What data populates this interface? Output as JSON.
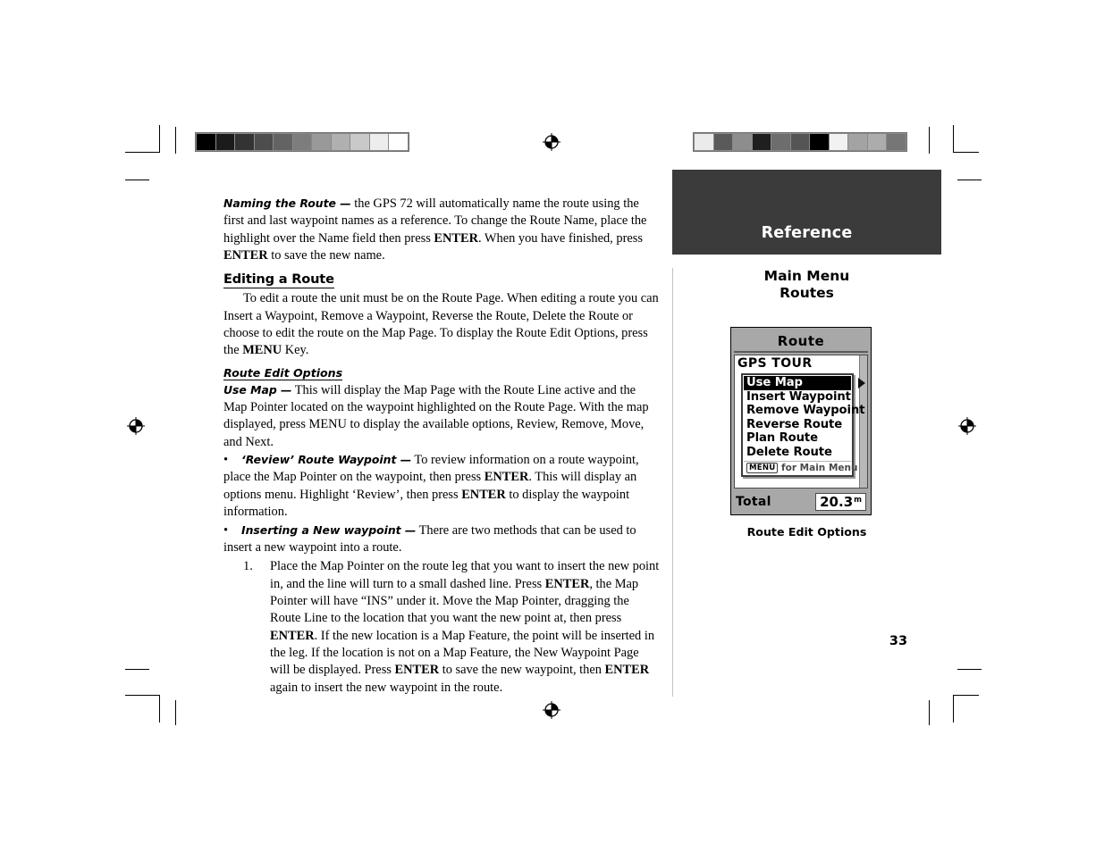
{
  "page": {
    "number": "33",
    "banner_label": "Reference",
    "sidebar_title_line1": "Main Menu",
    "sidebar_title_line2": "Routes",
    "figure_caption": "Route Edit Options"
  },
  "colors": {
    "banner_background": "#3b3b3b",
    "banner_text": "#ffffff",
    "rule": "#c3c3c3",
    "device_chrome": "#a8a8a8",
    "device_screen": "#ffffff",
    "highlight": "#000000"
  },
  "calibration": {
    "left_strip": [
      "#000000",
      "#1b1b1b",
      "#333333",
      "#4d4d4d",
      "#636363",
      "#7d7d7d",
      "#999999",
      "#b0b0b0",
      "#c9c9c9",
      "#ededed",
      "#ffffff"
    ],
    "right_strip": [
      "#ebebeb",
      "#5a5a5a",
      "#8d8d8d",
      "#1f1f1f",
      "#6d6d6d",
      "#555555",
      "#000000",
      "#f2f2f2",
      "#a3a3a3",
      "#acacac",
      "#767676"
    ]
  },
  "content": {
    "naming_route": {
      "lead": "Naming the Route —",
      "text_1": " the GPS 72 will automatically name the route using the first and last waypoint names as a reference.  To change the Route Name, place the highlight over the Name field then press ",
      "key_1": "ENTER",
      "text_2": ".  When you have finished, press ",
      "key_2": "ENTER",
      "text_3": " to save the new name."
    },
    "editing_route_heading": "Editing a Route",
    "editing_route_body": {
      "text_1": "To edit a route the unit must be on the Route Page.  When editing a route you can Insert a Waypoint, Remove a Waypoint, Reverse the Route, Delete the Route or choose to edit the route on the Map Page.  To display the Route Edit Options, press the ",
      "key_1": "MENU",
      "text_2": " Key."
    },
    "route_edit_options_heading": "Route Edit Options",
    "use_map": {
      "lead": "Use Map —",
      "text_1": " This will display the Map Page with the Route Line active and the Map Pointer located on the waypoint highlighted on the Route Page.  With the map displayed, press MENU to display the available options, Review, Remove, Move, and Next."
    },
    "review_waypoint": {
      "bullet": "•",
      "lead": "‘Review’ Route Waypoint —",
      "text_1": " To review information on a route waypoint, place     the Map Pointer on the waypoint, then press ",
      "key_1": "ENTER",
      "text_2": ". This will display an options menu. Highlight ‘Review’, then press ",
      "key_2": "ENTER",
      "text_3": " to display the waypoint information."
    },
    "inserting_waypoint": {
      "bullet": "•",
      "lead": "Inserting a New waypoint —",
      "text_1": " There are two methods that can be used to insert     a new waypoint into a route."
    },
    "step_1": {
      "num": "1.",
      "text_1": "Place the Map Pointer on the route leg that you want to insert the new point in, and the line will turn to a small dashed line.  Press ",
      "key_1": "ENTER",
      "text_2": ", the Map Pointer will have “INS” under it.  Move the Map Pointer, dragging the Route Line to the location that you want the new point at, then press ",
      "key_2": "ENTER",
      "text_3": ".  If the new location is a Map Feature, the point will be inserted in the leg.  If the location is not on a Map Feature, the New Waypoint Page will be displayed.  Press ",
      "key_3": "ENTER",
      "text_4": " to save the new waypoint, then ",
      "key_4": "ENTER",
      "text_5": " again to insert the new waypoint in the route."
    }
  },
  "gps_figure": {
    "title": "Route",
    "route_name": "GPS TOUR",
    "menu_items": [
      {
        "label": "Use Map",
        "selected": true
      },
      {
        "label": "Insert Waypoint",
        "selected": false
      },
      {
        "label": "Remove Waypoint",
        "selected": false
      },
      {
        "label": "Reverse Route",
        "selected": false
      },
      {
        "label": "Plan Route",
        "selected": false
      },
      {
        "label": "Delete Route",
        "selected": false
      }
    ],
    "footer_chip": "MENU",
    "footer_hint": " for Main Menu",
    "total_label": "Total",
    "total_value": "20.3",
    "total_unit": "m"
  }
}
